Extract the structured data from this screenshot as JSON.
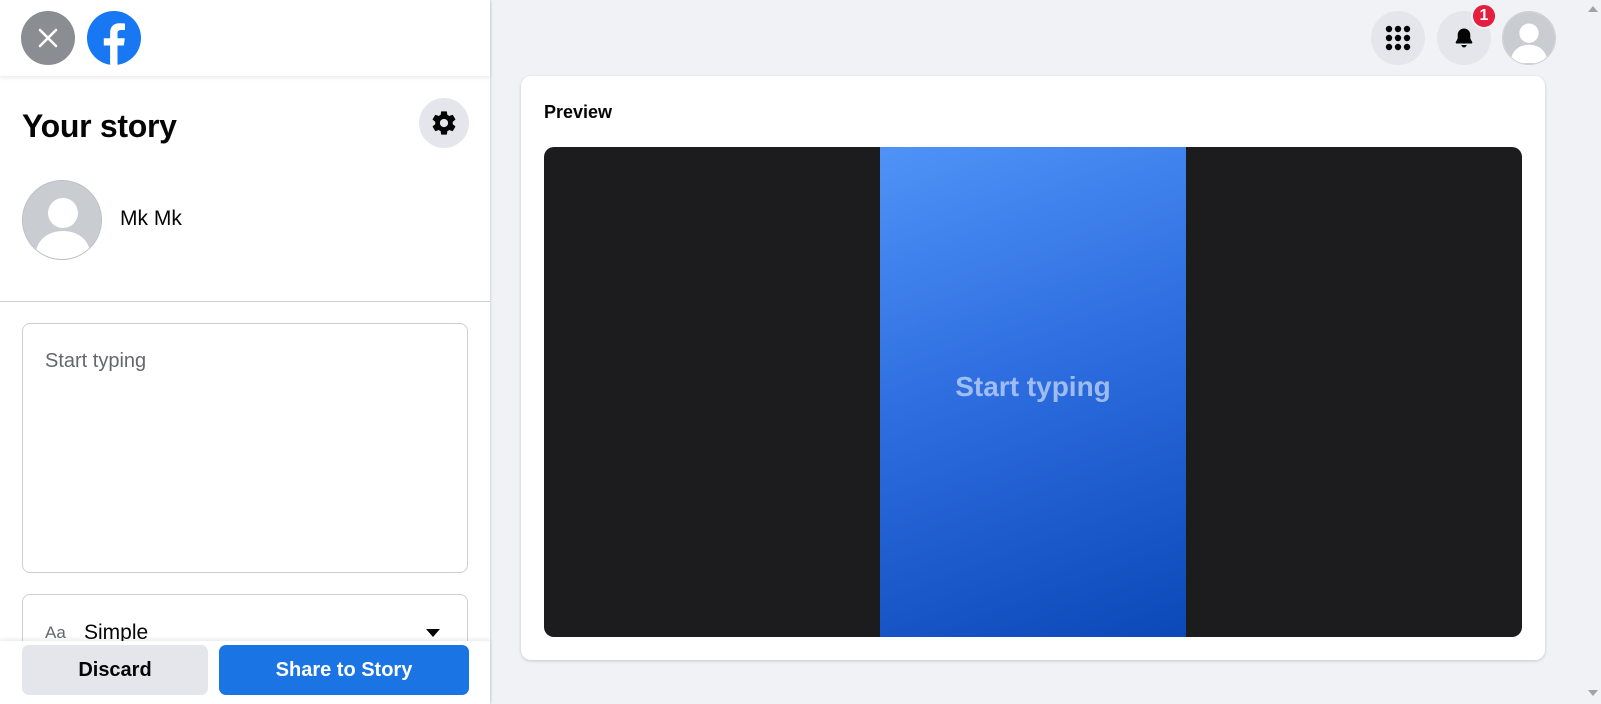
{
  "header": {
    "close_icon": "close-icon",
    "logo_icon": "facebook-logo-icon",
    "menu_icon": "grid-menu-icon",
    "notifications_icon": "bell-icon",
    "notifications_count": "1",
    "profile_icon": "avatar-icon"
  },
  "sidebar": {
    "title": "Your story",
    "settings_icon": "gear-icon",
    "user": {
      "name": "Mk Mk",
      "avatar_icon": "default-avatar-icon"
    },
    "text_input": {
      "placeholder": "Start typing",
      "value": ""
    },
    "font_select": {
      "prefix": "Aa",
      "value": "Simple",
      "caret_icon": "caret-down-icon"
    },
    "actions": {
      "discard_label": "Discard",
      "share_label": "Share to Story"
    }
  },
  "preview": {
    "label": "Preview",
    "story_text": "Start typing",
    "background_start": "#4f93f7",
    "background_end": "#0b48b8"
  },
  "colors": {
    "primary": "#1b74e4",
    "badge": "#e41e3f",
    "stage": "#1c1c1e",
    "page_bg": "#f0f2f5"
  }
}
